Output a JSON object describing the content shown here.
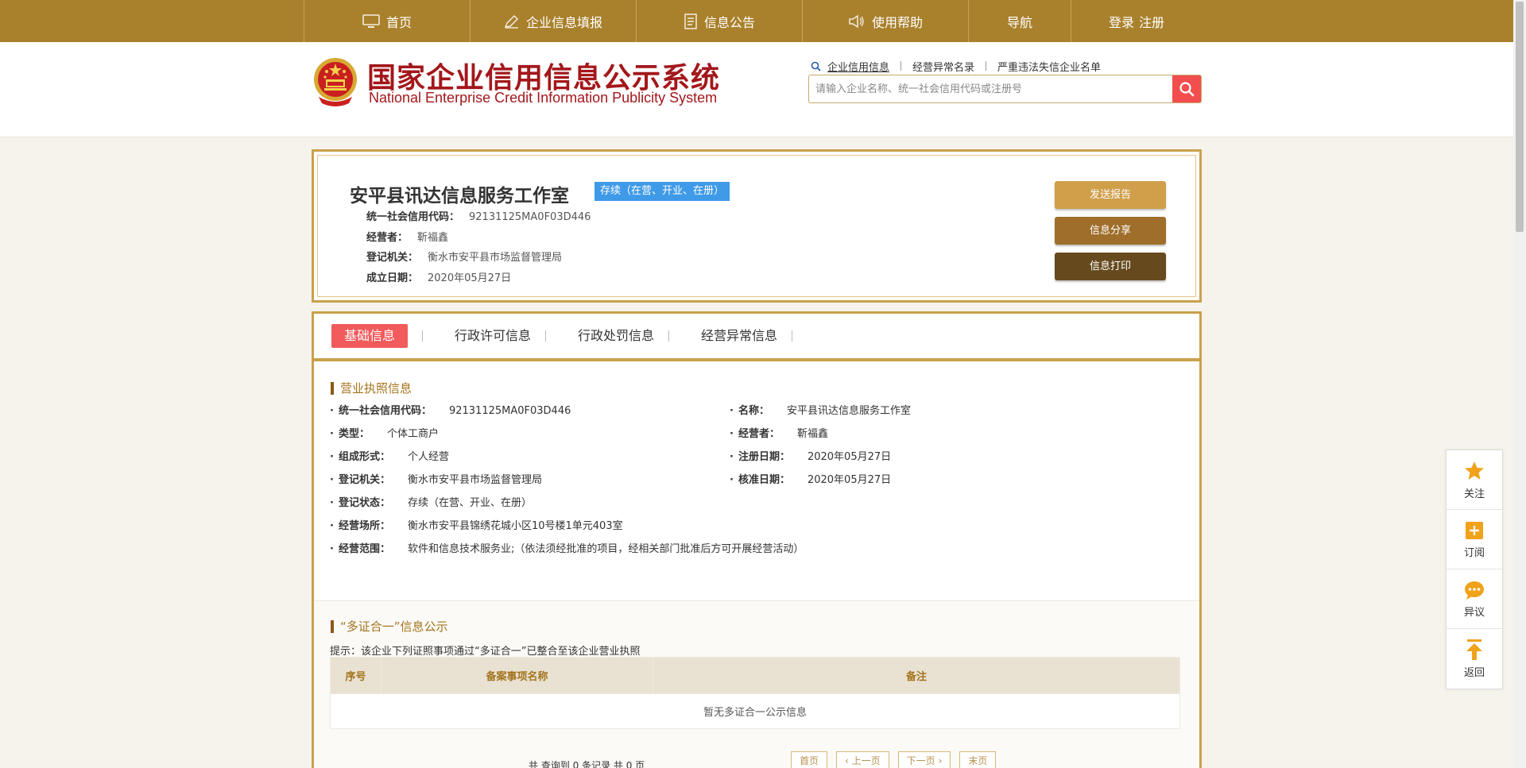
{
  "nav": {
    "home": "首页",
    "fill": "企业信息填报",
    "notice": "信息公告",
    "help": "使用帮助",
    "guide": "导航",
    "login": "登录",
    "register": "注册"
  },
  "header": {
    "title_cn": "国家企业信用信息公示系统",
    "title_en": "National Enterprise Credit Information Publicity System",
    "search_tabs": [
      "企业信用信息",
      "经营异常名录",
      "严重违法失信企业名单"
    ],
    "search_placeholder": "请输入企业名称、统一社会信用代码或注册号"
  },
  "company": {
    "name": "安平县讯达信息服务工作室",
    "status": "存续（在营、开业、在册）",
    "rows": [
      {
        "label": "统一社会信用代码：",
        "value": "92131125MA0F03D446"
      },
      {
        "label": "经营者：",
        "value": "靳福鑫"
      },
      {
        "label": "登记机关：",
        "value": "衡水市安平县市场监督管理局"
      },
      {
        "label": "成立日期：",
        "value": "2020年05月27日"
      }
    ],
    "buttons": {
      "report": "发送报告",
      "share": "信息分享",
      "print": "信息打印"
    }
  },
  "tabs": [
    "基础信息",
    "行政许可信息",
    "行政处罚信息",
    "经营异常信息"
  ],
  "license": {
    "section_title": "营业执照信息",
    "left": [
      {
        "label": "统一社会信用代码：",
        "value": "92131125MA0F03D446"
      },
      {
        "label": "类型：",
        "value": "个体工商户"
      },
      {
        "label": "组成形式：",
        "value": "个人经营"
      },
      {
        "label": "登记机关：",
        "value": "衡水市安平县市场监督管理局"
      },
      {
        "label": "登记状态：",
        "value": "存续（在营、开业、在册）"
      },
      {
        "label": "经营场所：",
        "value": "衡水市安平县锦绣花城小区10号楼1单元403室"
      },
      {
        "label": "经营范围：",
        "value": "软件和信息技术服务业;（依法须经批准的项目，经相关部门批准后方可开展经营活动）"
      }
    ],
    "right": [
      {
        "label": "名称：",
        "value": "安平县讯达信息服务工作室"
      },
      {
        "label": "经营者：",
        "value": "靳福鑫"
      },
      {
        "label": "注册日期：",
        "value": "2020年05月27日"
      },
      {
        "label": "核准日期：",
        "value": "2020年05月27日"
      }
    ]
  },
  "multi": {
    "section_title": "“多证合一”信息公示",
    "hint": "提示：该企业下列证照事项通过“多证合一”已整合至该企业营业执照",
    "columns": [
      "序号",
      "备案事项名称",
      "备注"
    ],
    "empty": "暂无多证合一公示信息",
    "pager_text": "共 查询到 0 条记录 共 0 页",
    "pager": {
      "first": "首页",
      "prev": "上一页",
      "next": "下一页",
      "last": "末页"
    }
  },
  "floatbar": {
    "follow": "关注",
    "subscribe": "订阅",
    "objection": "异议",
    "back": "返回"
  },
  "colors": {
    "nav_bg": "#a9812c",
    "accent_red": "#f25b5b",
    "badge_blue": "#3f9ae8",
    "frame_gold": "#c9a14a"
  }
}
